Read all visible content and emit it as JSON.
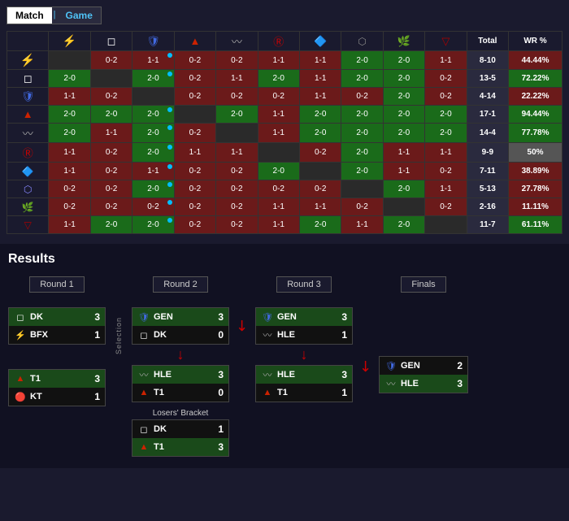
{
  "tabs": {
    "match": "Match",
    "game": "Game",
    "divider": "|"
  },
  "table": {
    "headers": [
      "",
      "BFX",
      "DK",
      "GEN",
      "T1",
      "HLE",
      "R?",
      "KT",
      "DRX?",
      "AF?",
      "NS?",
      "Total",
      "WR %"
    ],
    "rows": [
      {
        "team": "BFX",
        "icon": "bfx",
        "cells": [
          "",
          "0-2",
          "1-1",
          "0-2",
          "0-2",
          "1-1",
          "1-1",
          "2-0",
          "2-0",
          "1-1",
          "8-10",
          "44.44%"
        ],
        "wr_class": "cell-wr-bad"
      },
      {
        "team": "DK",
        "icon": "dk",
        "cells": [
          "2-0",
          "",
          "2-0",
          "0-2",
          "1-1",
          "2-0",
          "1-1",
          "2-0",
          "2-0",
          "0-2",
          "13-5",
          "72.22%"
        ],
        "wr_class": "cell-wr-good"
      },
      {
        "team": "GEN",
        "icon": "gen",
        "cells": [
          "1-1",
          "0-2",
          "",
          "0-2",
          "0-2",
          "0-2",
          "1-1",
          "0-2",
          "2-0",
          "0-2",
          "4-14",
          "22.22%"
        ],
        "wr_class": "cell-wr-bad"
      },
      {
        "team": "T1",
        "icon": "t1",
        "cells": [
          "2-0",
          "2-0",
          "2-0",
          "",
          "2-0",
          "1-1",
          "2-0",
          "2-0",
          "2-0",
          "2-0",
          "17-1",
          "94.44%"
        ],
        "wr_class": "cell-wr-good"
      },
      {
        "team": "HLE",
        "icon": "hle",
        "cells": [
          "2-0",
          "1-1",
          "2-0",
          "0-2",
          "",
          "1-1",
          "2-0",
          "2-0",
          "2-0",
          "2-0",
          "14-4",
          "77.78%"
        ],
        "wr_class": "cell-wr-good"
      },
      {
        "team": "R",
        "icon": "r",
        "cells": [
          "1-1",
          "0-2",
          "2-0",
          "1-1",
          "1-1",
          "",
          "0-2",
          "2-0",
          "1-1",
          "1-1",
          "9-9",
          "50%"
        ],
        "wr_class": "cell-wr-mid"
      },
      {
        "team": "KT",
        "icon": "kt",
        "cells": [
          "1-1",
          "0-2",
          "1-1",
          "0-2",
          "0-2",
          "2-0",
          "",
          "2-0",
          "1-1",
          "0-2",
          "7-11",
          "38.89%"
        ],
        "wr_class": "cell-wr-bad"
      },
      {
        "team": "DRX",
        "icon": "drx",
        "cells": [
          "0-2",
          "0-2",
          "2-0",
          "0-2",
          "0-2",
          "0-2",
          "0-2",
          "",
          "2-0",
          "1-1",
          "5-13",
          "27.78%"
        ],
        "wr_class": "cell-wr-bad"
      },
      {
        "team": "AF",
        "icon": "af",
        "cells": [
          "0-2",
          "0-2",
          "0-2",
          "0-2",
          "0-2",
          "1-1",
          "1-1",
          "0-2",
          "",
          "0-2",
          "2-16",
          "11.11%"
        ],
        "wr_class": "cell-wr-bad"
      },
      {
        "team": "NS",
        "icon": "ns",
        "cells": [
          "1-1",
          "2-0",
          "2-0",
          "0-2",
          "0-2",
          "1-1",
          "2-0",
          "1-1",
          "2-0",
          "",
          "11-7",
          "61.11%"
        ],
        "wr_class": "cell-wr-good"
      }
    ]
  },
  "results": {
    "title": "Results",
    "rounds": {
      "r1": "Round 1",
      "r2": "Round 2",
      "r3": "Round 3",
      "finals": "Finals"
    },
    "r1_matches": [
      {
        "teams": [
          {
            "name": "DK",
            "icon": "dk",
            "score": "3",
            "result": "winner"
          },
          {
            "name": "BFX",
            "icon": "bfx",
            "score": "1",
            "result": "loser"
          }
        ]
      },
      {
        "teams": [
          {
            "name": "T1",
            "icon": "t1",
            "score": "3",
            "result": "winner"
          },
          {
            "name": "KT",
            "icon": "kt",
            "score": "1",
            "result": "loser"
          }
        ]
      }
    ],
    "r2_matches": [
      {
        "label": "",
        "teams": [
          {
            "name": "GEN",
            "icon": "gen",
            "score": "3",
            "result": "winner"
          },
          {
            "name": "DK",
            "icon": "dk",
            "score": "0",
            "result": "loser"
          }
        ]
      },
      {
        "label": "",
        "teams": [
          {
            "name": "HLE",
            "icon": "hle",
            "score": "3",
            "result": "winner"
          },
          {
            "name": "T1",
            "icon": "t1",
            "score": "0",
            "result": "loser"
          }
        ]
      }
    ],
    "r2_losers": [
      {
        "label": "Losers' Bracket",
        "teams": [
          {
            "name": "DK",
            "icon": "dk",
            "score": "1",
            "result": "loser"
          },
          {
            "name": "T1",
            "icon": "t1",
            "score": "3",
            "result": "winner"
          }
        ]
      }
    ],
    "r3_matches": [
      {
        "teams": [
          {
            "name": "GEN",
            "icon": "gen",
            "score": "3",
            "result": "winner"
          },
          {
            "name": "HLE",
            "icon": "hle",
            "score": "1",
            "result": "loser"
          }
        ]
      },
      {
        "teams": [
          {
            "name": "HLE",
            "icon": "hle",
            "score": "3",
            "result": "winner"
          },
          {
            "name": "T1",
            "icon": "t1",
            "score": "1",
            "result": "loser"
          }
        ]
      }
    ],
    "finals_match": {
      "teams": [
        {
          "name": "GEN",
          "icon": "gen",
          "score": "2",
          "result": "loser"
        },
        {
          "name": "HLE",
          "icon": "hle",
          "score": "3",
          "result": "winner"
        }
      ]
    },
    "selection_label": "Selection"
  },
  "team_icons": {
    "bfx": "⚡",
    "dk": "◻",
    "gen": "🛡",
    "t1": "🔰",
    "kt": "🔴",
    "hle": "〰",
    "r": "®",
    "drx": "◇",
    "af": "🌿",
    "ns": "🔻"
  },
  "team_colors": {
    "bfx": "#ffd700",
    "dk": "#ffffff",
    "gen": "#4169e1",
    "t1": "#cc2200",
    "kt": "#cc0000",
    "hle": "#999999",
    "r": "#cc0000",
    "drx": "#8888ff",
    "af": "#228B22",
    "ns": "#aa0000"
  }
}
